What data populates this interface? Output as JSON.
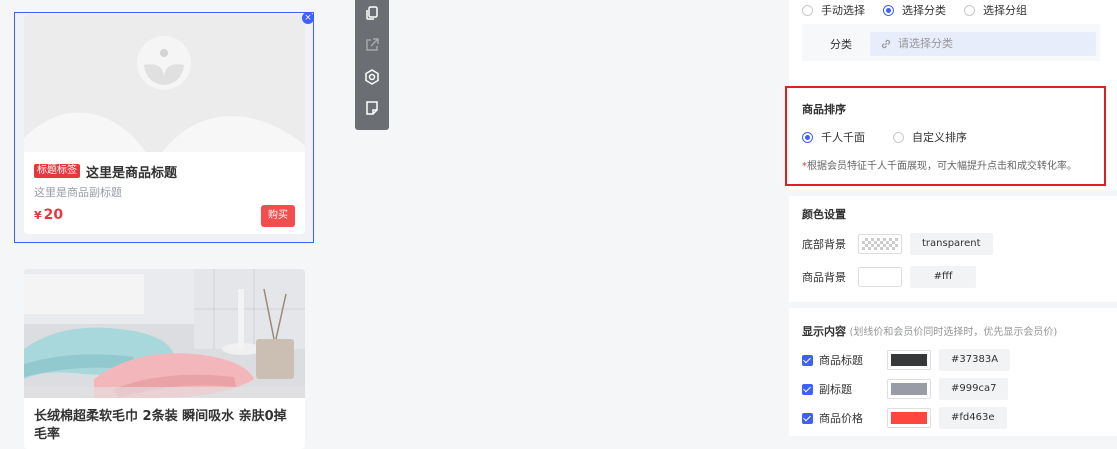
{
  "preview": {
    "card1": {
      "tag": "标题标签",
      "title": "这里是商品标题",
      "subtitle": "这里是商品副标题",
      "currency": "¥",
      "price": "20",
      "buy_label": "购买"
    },
    "card2": {
      "title": "长绒棉超柔软毛巾 2条装 瞬间吸水 亲肤0掉毛率"
    },
    "close_label": "×"
  },
  "toolbar": {
    "icons": [
      "copy-icon",
      "share-icon",
      "settings-icon",
      "note-icon"
    ]
  },
  "panel": {
    "source_options": [
      "手动选择",
      "选择分类",
      "选择分组"
    ],
    "source_selected": "选择分类",
    "category_label": "分类",
    "category_placeholder": "请选择分类",
    "sort": {
      "title": "商品排序",
      "options": [
        "千人千面",
        "自定义排序"
      ],
      "selected": "千人千面",
      "hint_star": "*",
      "hint": "根据会员特征千人千面展现，可大幅提升点击和成交转化率。"
    },
    "color": {
      "title": "颜色设置",
      "bottom_bg_label": "底部背景",
      "bottom_bg_value": "transparent",
      "goods_bg_label": "商品背景",
      "goods_bg_value": "#fff"
    },
    "display": {
      "title": "显示内容",
      "note": "(划线价和会员价同时选择时，优先显示会员价)",
      "items": [
        {
          "label": "商品标题",
          "value": "#37383A",
          "color": "#37383A"
        },
        {
          "label": "副标题",
          "value": "#999ca7",
          "color": "#999ca7"
        },
        {
          "label": "商品价格",
          "value": "#fd463e",
          "color": "#fd463e"
        }
      ]
    }
  },
  "colors": {
    "accent": "#3d5ffe",
    "danger": "#e02020",
    "price": "#e8373e"
  }
}
